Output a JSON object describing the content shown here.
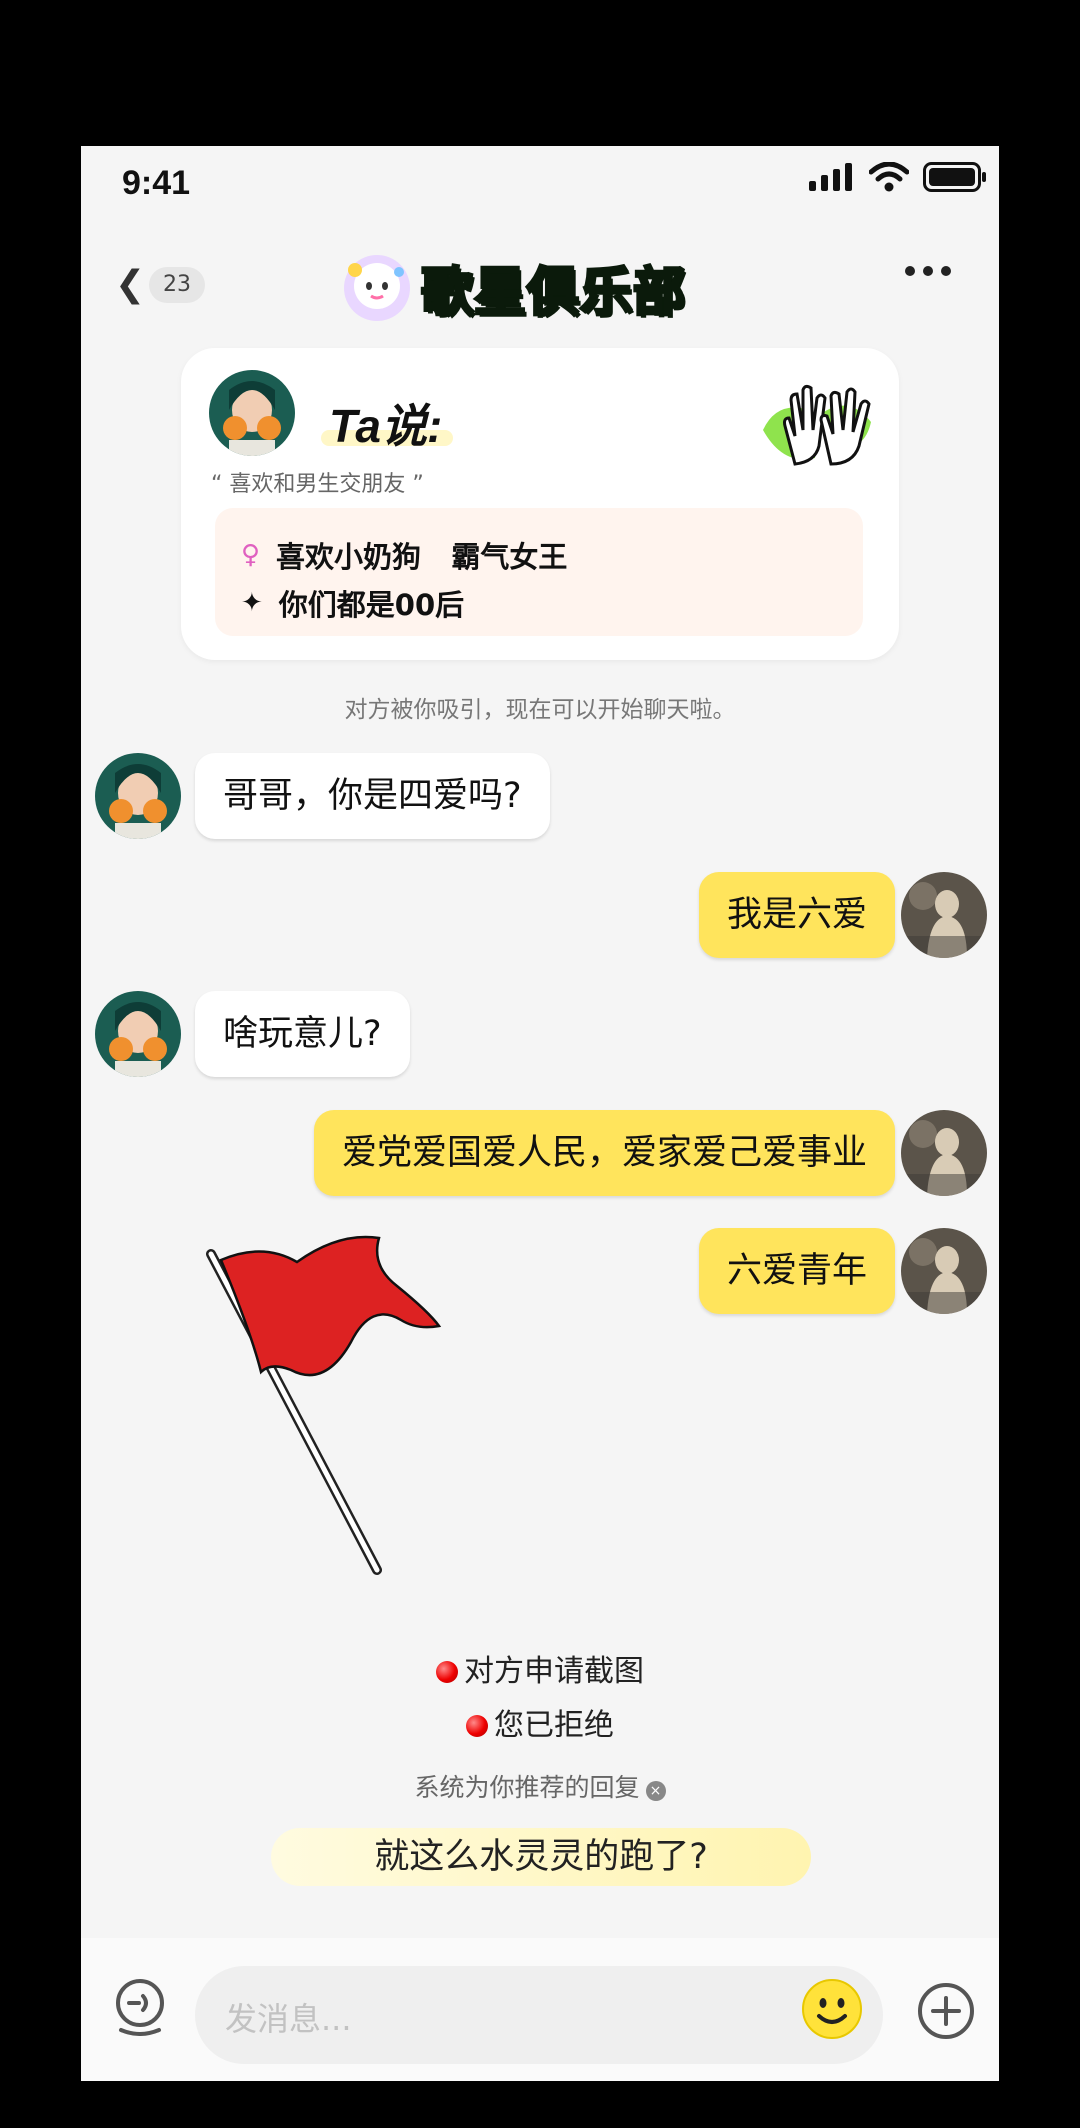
{
  "status": {
    "time": "9:41"
  },
  "nav": {
    "back_count": "23",
    "title": "歌星俱乐部"
  },
  "card": {
    "title": "Ta说:",
    "quote": "“ 喜欢和男生交朋友 ”",
    "tag1_icon": "♀",
    "tag1": "喜欢小奶狗   霸气女王",
    "tag2_icon": "✦",
    "tag2": "你们都是00后"
  },
  "system_note": "对方被你吸引，现在可以开始聊天啦。",
  "messages": [
    {
      "side": "left",
      "text": "哥哥，你是四爱吗?"
    },
    {
      "side": "right",
      "text": "我是六爱"
    },
    {
      "side": "left",
      "text": "啥玩意儿?"
    },
    {
      "side": "right",
      "text": "爱党爱国爱人民，爱家爱己爱事业"
    },
    {
      "side": "right",
      "text": "六爱青年"
    }
  ],
  "screenshot": {
    "request": "对方申请截图",
    "rejected": "您已拒绝"
  },
  "recommend": {
    "label": "系统为你推荐的回复",
    "close_icon": "×",
    "reply": "就这么水灵灵的跑了?"
  },
  "input": {
    "placeholder": "发消息..."
  },
  "colors": {
    "accent_yellow": "#ffe45c",
    "title_green": "#37e63b",
    "flag_red": "#dd2222"
  }
}
